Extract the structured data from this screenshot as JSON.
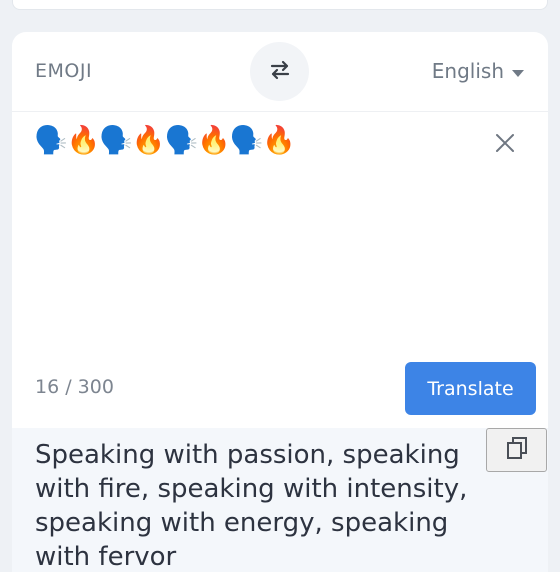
{
  "language_bar": {
    "source_language": "EMOJI",
    "target_language": "English"
  },
  "input": {
    "text": "🗣️🔥🗣️🔥🗣️🔥🗣️🔥",
    "char_count": "16 / 300"
  },
  "actions": {
    "translate_label": "Translate"
  },
  "output": {
    "text": "Speaking with passion, speaking with fire, speaking with intensity, speaking with energy, speaking with fervor"
  },
  "colors": {
    "accent": "#3d84e6",
    "muted_text": "#707a86",
    "output_bg": "#f4f7fb"
  },
  "icons": {
    "swap": "swap-arrows-icon",
    "dropdown": "caret-down-icon",
    "clear": "close-icon",
    "copy": "copy-icon"
  }
}
